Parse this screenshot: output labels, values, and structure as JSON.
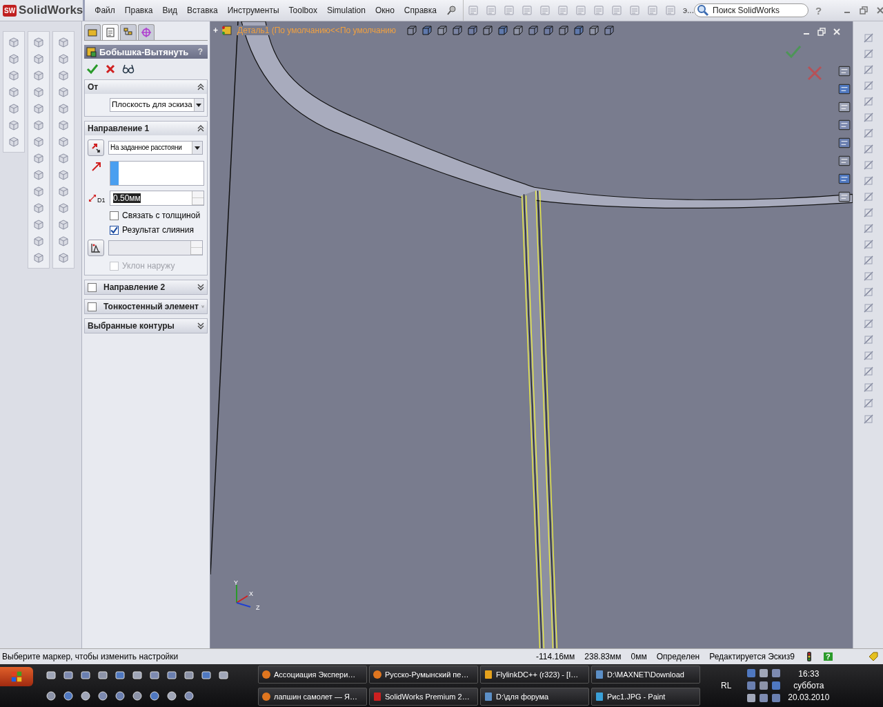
{
  "app": {
    "logo_badge": "SW",
    "logo": "SolidWorks"
  },
  "menu": [
    {
      "label": "Файл"
    },
    {
      "label": "Правка"
    },
    {
      "label": "Вид"
    },
    {
      "label": "Вставка"
    },
    {
      "label": "Инструменты"
    },
    {
      "label": "Toolbox"
    },
    {
      "label": "Simulation"
    },
    {
      "label": "Окно"
    },
    {
      "label": "Справка"
    }
  ],
  "toolbar": {
    "overflow": "э..."
  },
  "search": {
    "placeholder": "Поиск SolidWorks"
  },
  "help": "?",
  "property_manager": {
    "tabs": [
      {
        "selected": false
      },
      {
        "selected": true
      },
      {
        "selected": false
      },
      {
        "selected": false
      }
    ],
    "title": "Бобышка-Вытянуть",
    "help": "?",
    "sections": [
      {
        "kind": "from",
        "title": "От",
        "expanded": true,
        "value": "Плоскость для эскиза"
      },
      {
        "kind": "direction",
        "title": "Направление 1",
        "expanded": true,
        "end_condition": "На заданное расстояни",
        "depth_label": "D1",
        "depth": "0.50мм",
        "options": [
          {
            "label": "Связать с толщиной",
            "checked": false
          },
          {
            "label": "Результат слияния",
            "checked": true
          }
        ],
        "draft": {
          "label": "Уклон наружу",
          "checked": false,
          "disabled": true
        }
      },
      {
        "kind": "collapsed",
        "title": "Направление 2",
        "expanded": false,
        "has_checkbox": true,
        "checked": false
      },
      {
        "kind": "collapsed",
        "title": "Тонкостенный элемент",
        "expanded": false,
        "has_checkbox": true,
        "checked": false
      },
      {
        "kind": "collapsed",
        "title": "Выбранные контуры",
        "expanded": false,
        "has_checkbox": false
      }
    ]
  },
  "viewport": {
    "tree_toggle": "+",
    "tree_path": "Деталь1  (По умолчанию<<По умолчанию",
    "triad": {
      "y": "Y",
      "x": "X",
      "z": "Z"
    }
  },
  "status_bar": {
    "message": "Выберите маркер, чтобы изменить настройки",
    "fields": [
      "-114.16мм",
      "238.83мм",
      "0мм",
      "Определен",
      "Редактируется Эскиз9"
    ],
    "help": "?"
  },
  "taskbar": {
    "tasks": [
      {
        "label": "Ассоциация Экспери…"
      },
      {
        "label": "Русско-Румынский пе…"
      },
      {
        "label": "FlylinkDC++ (r323) - [I…"
      },
      {
        "label": "D:\\MAXNET\\Download"
      },
      {
        "label": "лапшин самолет — Я…"
      },
      {
        "label": "SolidWorks Premium 2…"
      },
      {
        "label": "D:\\для форума"
      },
      {
        "label": "Рис1.JPG - Paint"
      }
    ],
    "language": "RL",
    "time": "16:33",
    "day": "суббота",
    "date": "20.03.2010"
  }
}
